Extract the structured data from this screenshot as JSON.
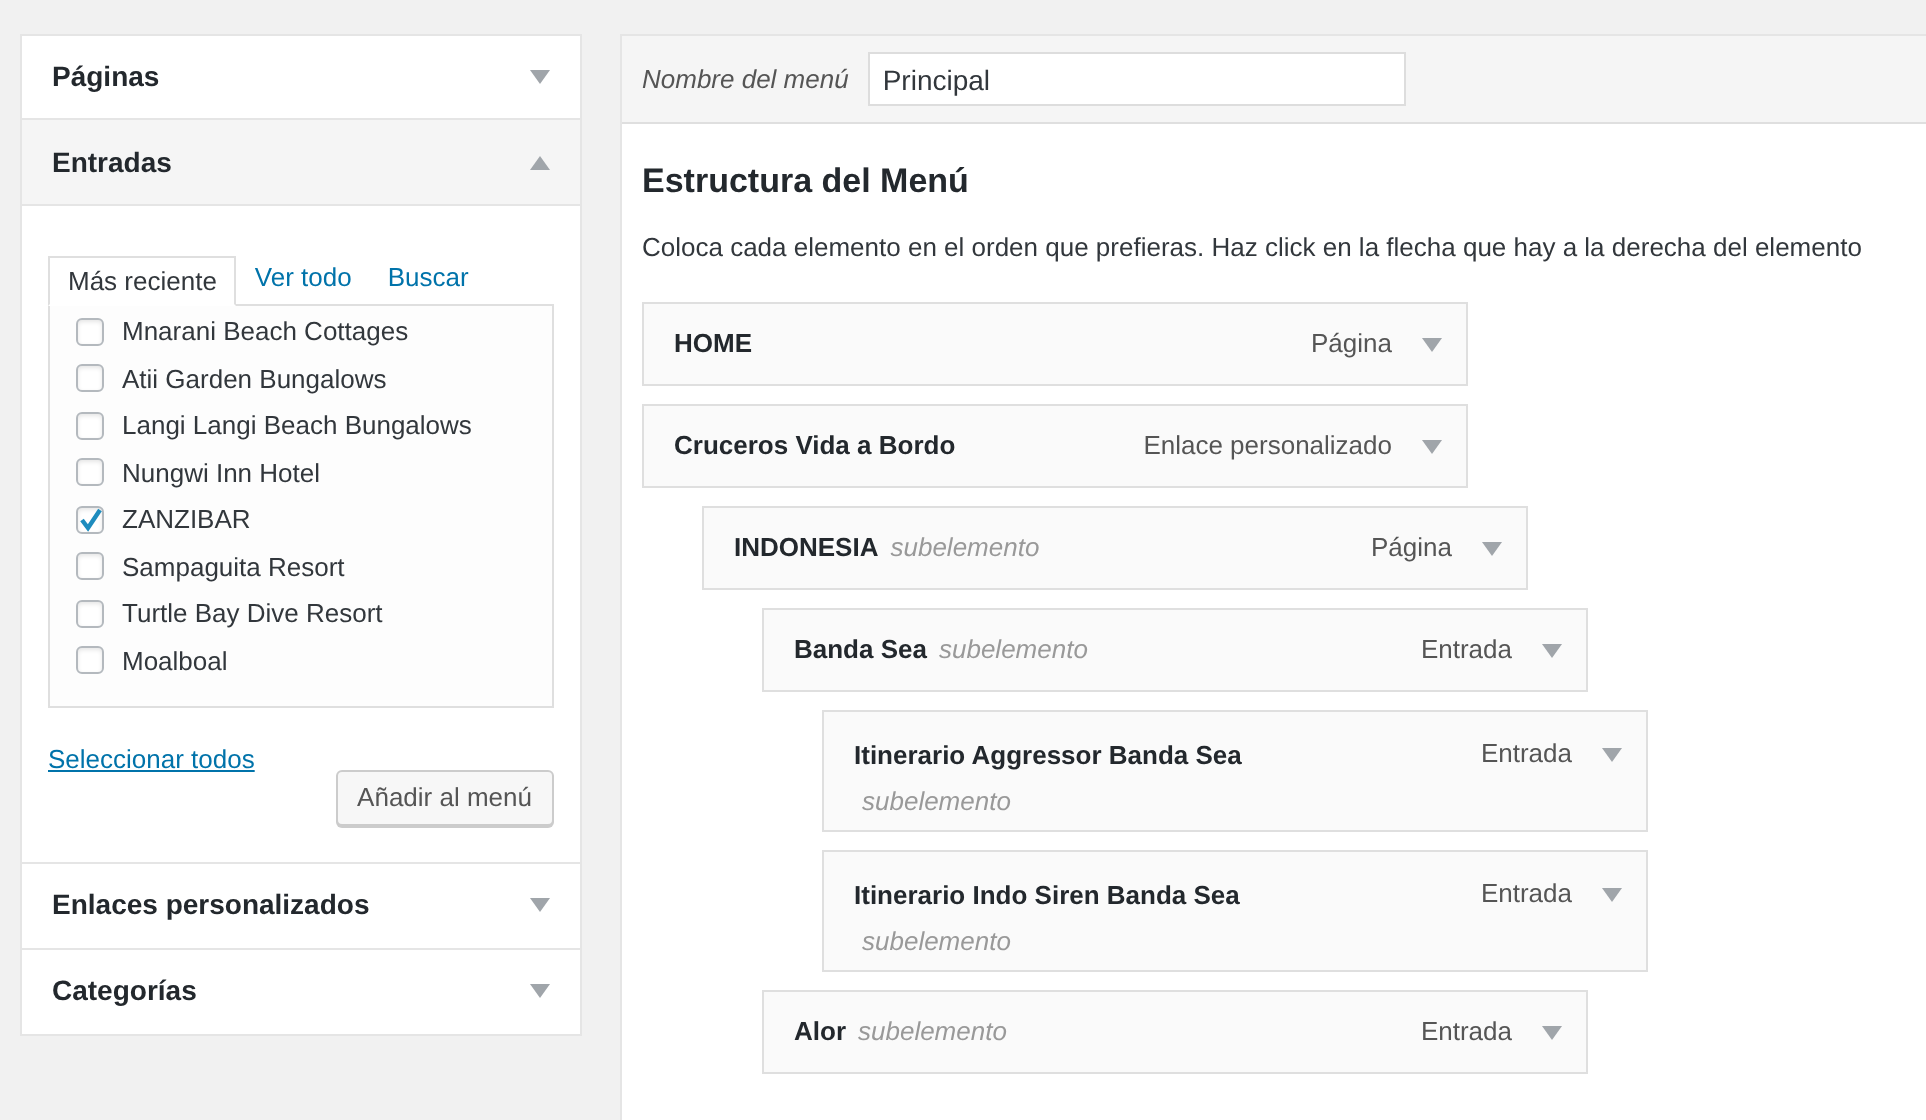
{
  "sidebar": {
    "sections": [
      {
        "title": "Páginas",
        "expanded": false
      },
      {
        "title": "Entradas",
        "expanded": true,
        "tabs": [
          {
            "label": "Más reciente",
            "selected": true
          },
          {
            "label": "Ver todo",
            "selected": false
          },
          {
            "label": "Buscar",
            "selected": false
          }
        ],
        "items": [
          {
            "label": "Mnarani Beach Cottages",
            "checked": false
          },
          {
            "label": "Atii Garden Bungalows",
            "checked": false
          },
          {
            "label": "Langi Langi Beach Bungalows",
            "checked": false
          },
          {
            "label": "Nungwi Inn Hotel",
            "checked": false
          },
          {
            "label": "ZANZIBAR",
            "checked": true
          },
          {
            "label": "Sampaguita Resort",
            "checked": false
          },
          {
            "label": "Turtle Bay Dive Resort",
            "checked": false
          },
          {
            "label": "Moalboal",
            "checked": false
          }
        ],
        "select_all": "Seleccionar todos",
        "add_button": "Añadir al menú"
      },
      {
        "title": "Enlaces personalizados",
        "expanded": false
      },
      {
        "title": "Categorías",
        "expanded": false
      }
    ]
  },
  "menu_name": {
    "label": "Nombre del menú",
    "value": "Principal"
  },
  "structure": {
    "title": "Estructura del Menú",
    "description": "Coloca cada elemento en el orden que prefieras. Haz click en la flecha que hay a la derecha del elemento",
    "items": [
      {
        "title": "HOME",
        "type": "Página"
      },
      {
        "title": "Cruceros Vida a Bordo",
        "type": "Enlace personalizado",
        "children": [
          {
            "title": "INDONESIA",
            "note": "subelemento",
            "type": "Página",
            "children": [
              {
                "title": "Banda Sea",
                "note": "subelemento",
                "type": "Entrada",
                "children": [
                  {
                    "title": "Itinerario Aggressor Banda Sea",
                    "note": "subelemento",
                    "type": "Entrada",
                    "kind": "two_line"
                  },
                  {
                    "title": "Itinerario Indo Siren Banda Sea",
                    "note": "subelemento",
                    "type": "Entrada",
                    "kind": "two_line"
                  }
                ]
              },
              {
                "title": "Alor",
                "note": "subelemento",
                "type": "Entrada"
              }
            ]
          }
        ]
      }
    ]
  }
}
